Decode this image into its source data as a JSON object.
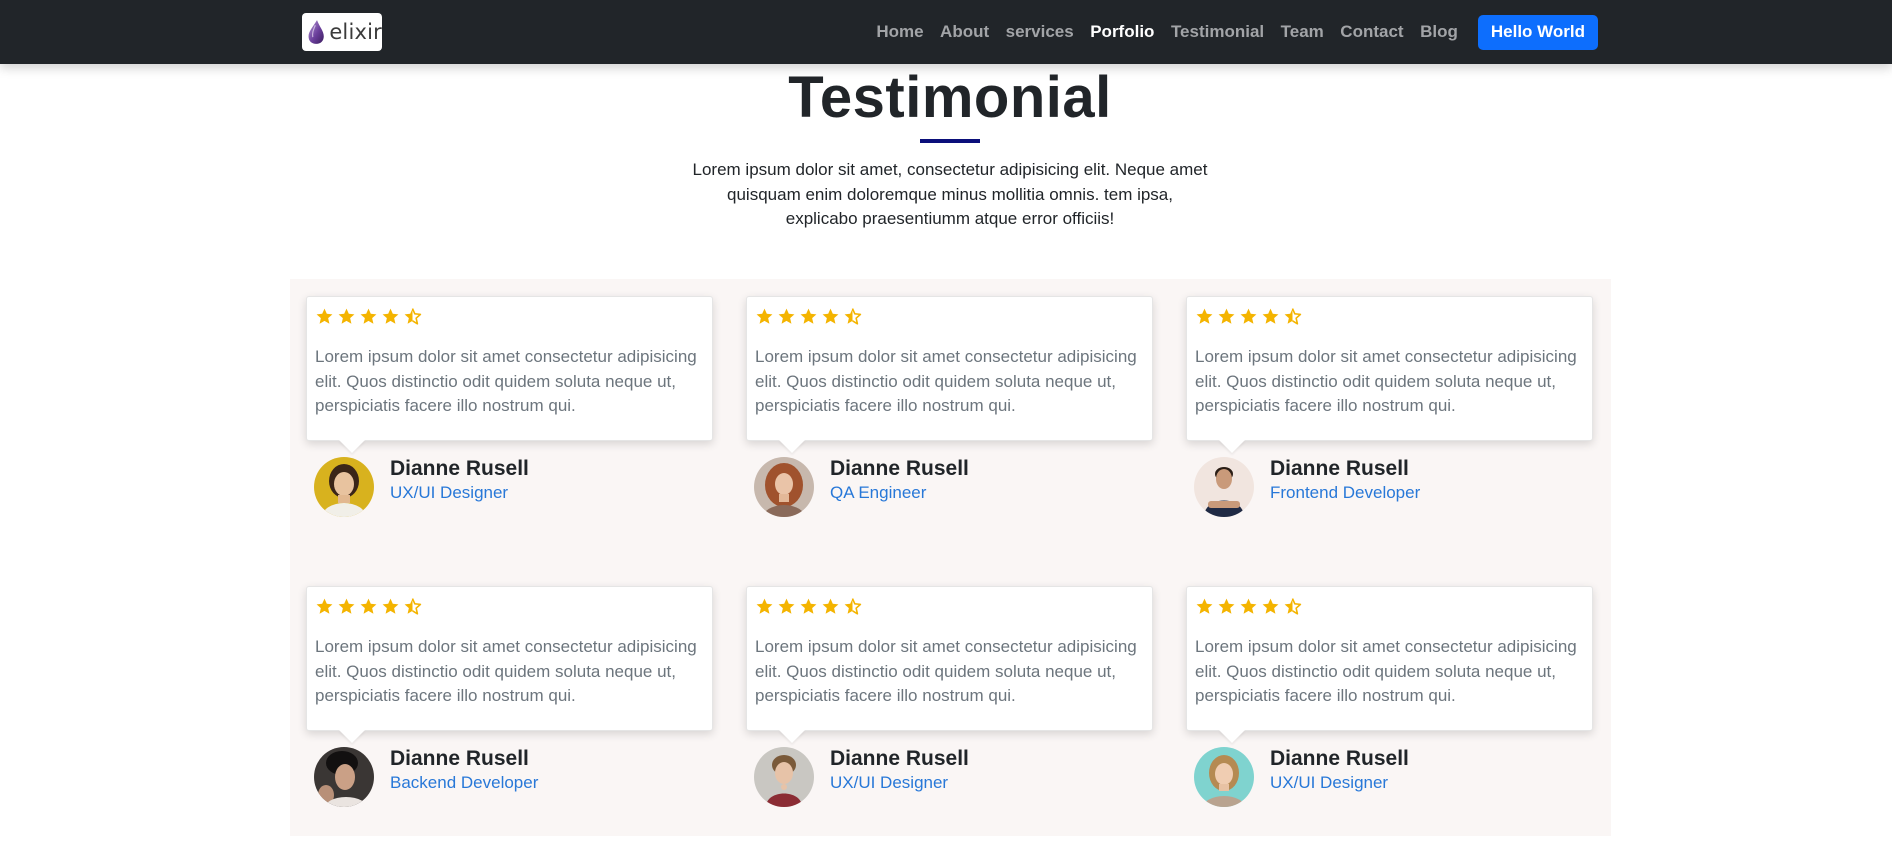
{
  "brand": {
    "name": "elixir",
    "icon": "elixir-drop-logo"
  },
  "nav": {
    "items": [
      {
        "label": "Home",
        "active": false
      },
      {
        "label": "About",
        "active": false
      },
      {
        "label": "services",
        "active": false
      },
      {
        "label": "Porfolio",
        "active": true
      },
      {
        "label": "Testimonial",
        "active": false
      },
      {
        "label": "Team",
        "active": false
      },
      {
        "label": "Contact",
        "active": false
      },
      {
        "label": "Blog",
        "active": false
      }
    ],
    "button_label": "Hello World"
  },
  "section": {
    "title": "Testimonial",
    "description": "Lorem ipsum dolor sit amet, consectetur adipisicing elit. Neque amet quisquam enim doloremque minus mollitia omnis. tem ipsa, explicabo praesentiumm atque error officiis!"
  },
  "colors": {
    "navbar_bg": "#212529",
    "accent_blue": "#0d6efd",
    "underline": "#0b0f7a",
    "star": "#f4b400",
    "role_text": "#2878d8",
    "grid_bg": "#faf6f5"
  },
  "testimonials": [
    {
      "rating": 4.5,
      "review": "Lorem ipsum dolor sit amet consectetur adipisicing elit. Quos distinctio odit quidem soluta neque ut, perspiciatis facere illo nostrum qui.",
      "name": "Dianne Rusell",
      "role": "UX/UI Designer",
      "avatar_icon": "avatar-woman-yellow-bg"
    },
    {
      "rating": 4.5,
      "review": "Lorem ipsum dolor sit amet consectetur adipisicing elit. Quos distinctio odit quidem soluta neque ut, perspiciatis facere illo nostrum qui.",
      "name": "Dianne Rusell",
      "role": "QA Engineer",
      "avatar_icon": "avatar-woman-red-hair"
    },
    {
      "rating": 4.5,
      "review": "Lorem ipsum dolor sit amet consectetur adipisicing elit. Quos distinctio odit quidem soluta neque ut, perspiciatis facere illo nostrum qui.",
      "name": "Dianne Rusell",
      "role": "Frontend Developer",
      "avatar_icon": "avatar-man-arms-crossed"
    },
    {
      "rating": 4.5,
      "review": "Lorem ipsum dolor sit amet consectetur adipisicing elit. Quos distinctio odit quidem soluta neque ut, perspiciatis facere illo nostrum qui.",
      "name": "Dianne Rusell",
      "role": "Backend Developer",
      "avatar_icon": "avatar-man-dark-hair"
    },
    {
      "rating": 4.5,
      "review": "Lorem ipsum dolor sit amet consectetur adipisicing elit. Quos distinctio odit quidem soluta neque ut, perspiciatis facere illo nostrum qui.",
      "name": "Dianne Rusell",
      "role": "UX/UI Designer",
      "avatar_icon": "avatar-man-curly-hair"
    },
    {
      "rating": 4.5,
      "review": "Lorem ipsum dolor sit amet consectetur adipisicing elit. Quos distinctio odit quidem soluta neque ut, perspiciatis facere illo nostrum qui.",
      "name": "Dianne Rusell",
      "role": "UX/UI Designer",
      "avatar_icon": "avatar-woman-teal-bg"
    }
  ]
}
